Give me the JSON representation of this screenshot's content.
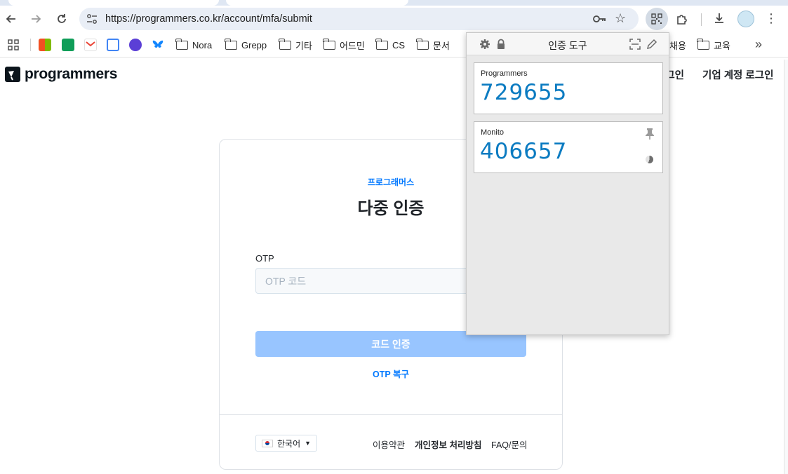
{
  "browser": {
    "url": "https://programmers.co.kr/account/mfa/submit",
    "bookmarks": [
      "Nora",
      "Grepp",
      "기타",
      "어드민",
      "CS",
      "문서",
      "채용",
      "교육"
    ]
  },
  "site": {
    "logo": "programmers",
    "header_links": [
      "로그인",
      "기업 계정 로그인"
    ]
  },
  "card": {
    "subtitle": "프로그래머스",
    "title": "다중 인증",
    "otp_label": "OTP",
    "otp_placeholder": "OTP 코드",
    "otp_value": "",
    "verify_button": "코드 인증",
    "recover_link": "OTP 복구",
    "language": "한국어",
    "footer_links": [
      "이용약관",
      "개인정보 처리방침",
      "FAQ/문의"
    ]
  },
  "authenticator": {
    "title": "인증 도구",
    "accounts": [
      {
        "issuer": "Programmers",
        "code": "729655"
      },
      {
        "issuer": "Monito",
        "code": "406657"
      }
    ]
  },
  "colors": {
    "accent": "#0078ff",
    "button_disabled": "#98c5ff",
    "otp_code": "#0b7bc1"
  }
}
